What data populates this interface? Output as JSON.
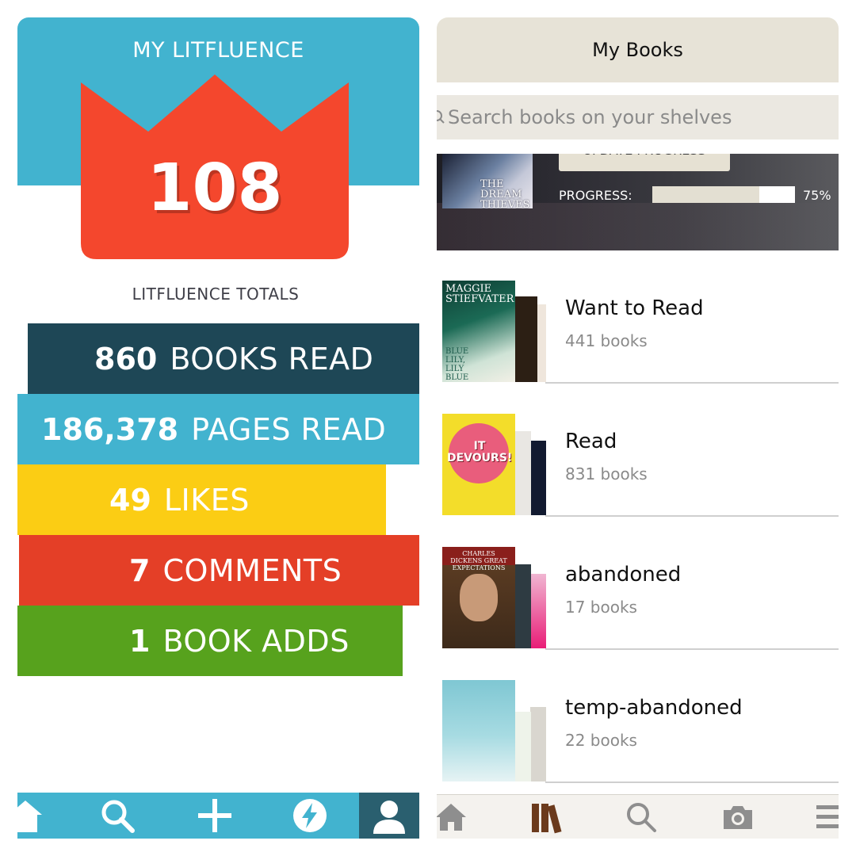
{
  "left_app": {
    "title": "MY LITFLUENCE",
    "score": "108",
    "totals_label": "LITFLUENCE TOTALS",
    "stats": [
      {
        "number": "860",
        "label": "BOOKS READ",
        "color": "#1e4756"
      },
      {
        "number": "186,378",
        "label": "PAGES READ",
        "color": "#42b3cf"
      },
      {
        "number": "49",
        "label": "LIKES",
        "color": "#fbcd14"
      },
      {
        "number": "7",
        "label": "COMMENTS",
        "color": "#e43f27"
      },
      {
        "number": "1",
        "label": "BOOK ADDS",
        "color": "#57a21d"
      }
    ],
    "tabs": [
      {
        "icon": "home-icon"
      },
      {
        "icon": "search-icon"
      },
      {
        "icon": "plus-icon"
      },
      {
        "icon": "lightning-icon"
      },
      {
        "icon": "profile-icon",
        "active": true
      }
    ],
    "colors": {
      "accent": "#42b3cf",
      "crown": "#f4472d"
    }
  },
  "right_app": {
    "header_title": "My Books",
    "search_placeholder": "Search books on your shelves",
    "currently_reading": {
      "cover_text": "THE DREAM THIEVES",
      "button_label": "UPDATE PROGRESS",
      "progress_label": "PROGRESS:",
      "progress_value": 0.75,
      "progress_text": "75%"
    },
    "shelves": [
      {
        "name": "Want to Read",
        "count": "441 books",
        "cover_text": "MAGGIE STIEFVATER",
        "cover_subtext": "BLUE LILY, LILY BLUE"
      },
      {
        "name": "Read",
        "count": "831 books",
        "cover_text": "IT DEVOURS!"
      },
      {
        "name": "abandoned",
        "count": "17 books",
        "cover_text": "CHARLES DICKENS GREAT EXPECTATIONS"
      },
      {
        "name": "temp-abandoned",
        "count": "22 books",
        "cover_text": ""
      }
    ],
    "tabs": [
      {
        "icon": "home-icon"
      },
      {
        "icon": "books-icon",
        "active": true
      },
      {
        "icon": "search-icon"
      },
      {
        "icon": "camera-icon"
      },
      {
        "icon": "menu-icon"
      }
    ],
    "colors": {
      "header": "#e7e3d7",
      "active_tab": "#6b3a1c",
      "inactive_tab": "#8e8e8e"
    }
  }
}
